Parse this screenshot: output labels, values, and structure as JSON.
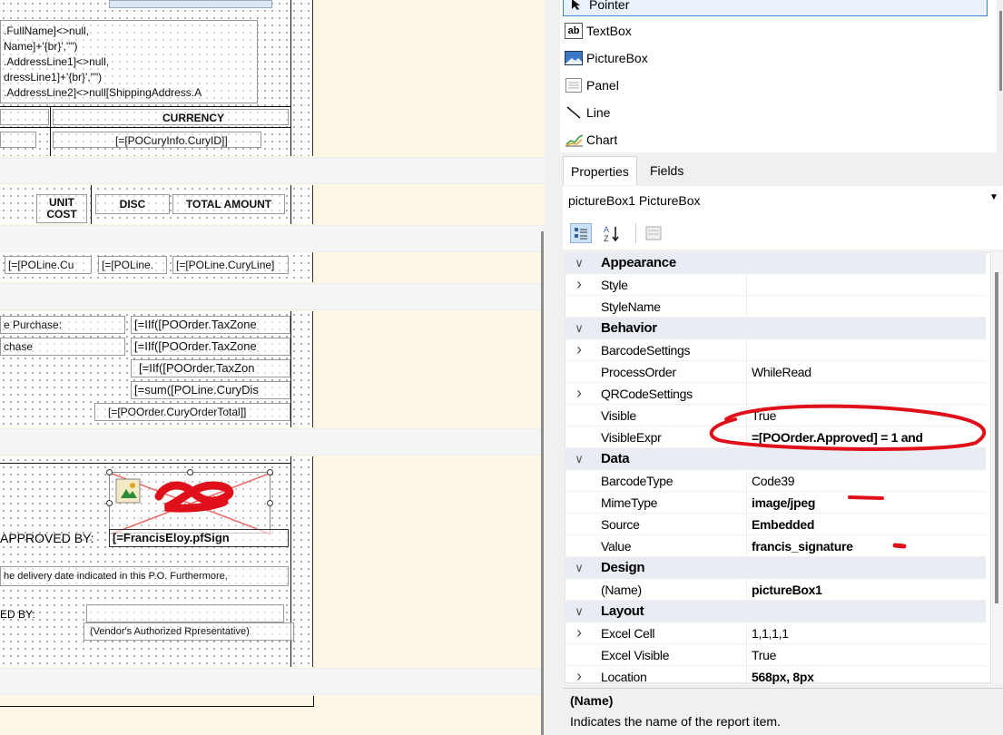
{
  "designer": {
    "detail_lines": [
      ".FullName]<>null,",
      "Name]+'{br}',\"\")",
      ".AddressLine1]<>null,",
      "dressLine1]+'{br}',\"\")",
      ".AddressLine2]<>null[ShippingAddress.A"
    ],
    "currency_header": "CURRENCY",
    "currency_value": "[=[POCuryInfo.CuryID]]",
    "col_unit_cost": "UNIT COST",
    "col_disc": "DISC",
    "col_total_amount": "TOTAL AMOUNT",
    "line_cells": [
      "[=[POLine.Cu",
      "[=[POLine.",
      "[=[POLine.CuryLine]"
    ],
    "summary_labels": [
      "e Purchase:",
      "chase"
    ],
    "summary_values": [
      "[=IIf([POOrder.TaxZone",
      "[=IIf([POOrder.TaxZone",
      "[=IIf([POOrder.TaxZon",
      "[=sum([POLine.CuryDis",
      "[=[POOrder.CuryOrderTotal]]"
    ],
    "approved_by_label": "APPROVED BY:",
    "approved_by_value": "[=FrancisEloy.pfSign",
    "terms_text": "he delivery date indicated in this P.O. Furthermore,",
    "received_by_label": "ED BY:",
    "vendor_rep": "(Vendor's Authorized Rpresentative)"
  },
  "toolbox": {
    "items": [
      {
        "label": "Pointer",
        "icon": "pointer-icon"
      },
      {
        "label": "TextBox",
        "icon": "textbox-icon"
      },
      {
        "label": "PictureBox",
        "icon": "picturebox-icon"
      },
      {
        "label": "Panel",
        "icon": "panel-icon"
      },
      {
        "label": "Line",
        "icon": "line-icon"
      },
      {
        "label": "Chart",
        "icon": "chart-icon"
      }
    ]
  },
  "tabs": {
    "properties": "Properties",
    "fields": "Fields"
  },
  "object_selector": "pictureBox1 PictureBox",
  "property_grid": {
    "rows": [
      {
        "kind": "category",
        "name": "Appearance"
      },
      {
        "kind": "prop",
        "name": "Style",
        "value": "",
        "expandable": true
      },
      {
        "kind": "prop",
        "name": "StyleName",
        "value": ""
      },
      {
        "kind": "category",
        "name": "Behavior"
      },
      {
        "kind": "prop",
        "name": "BarcodeSettings",
        "value": "",
        "expandable": true
      },
      {
        "kind": "prop",
        "name": "ProcessOrder",
        "value": "WhileRead"
      },
      {
        "kind": "prop",
        "name": "QRCodeSettings",
        "value": "",
        "expandable": true
      },
      {
        "kind": "prop",
        "name": "Visible",
        "value": "True"
      },
      {
        "kind": "prop",
        "name": "VisibleExpr",
        "value": "=[POOrder.Approved] = 1 and",
        "bold": true
      },
      {
        "kind": "category",
        "name": "Data"
      },
      {
        "kind": "prop",
        "name": "BarcodeType",
        "value": "Code39"
      },
      {
        "kind": "prop",
        "name": "MimeType",
        "value": "image/jpeg",
        "bold": true
      },
      {
        "kind": "prop",
        "name": "Source",
        "value": "Embedded",
        "bold": true
      },
      {
        "kind": "prop",
        "name": "Value",
        "value": "francis_signature",
        "bold": true
      },
      {
        "kind": "category",
        "name": "Design"
      },
      {
        "kind": "prop",
        "name": "(Name)",
        "value": "pictureBox1",
        "bold": true
      },
      {
        "kind": "category",
        "name": "Layout"
      },
      {
        "kind": "prop",
        "name": "Excel Cell",
        "value": "1,1,1,1",
        "expandable": true
      },
      {
        "kind": "prop",
        "name": "Excel Visible",
        "value": "True"
      },
      {
        "kind": "prop",
        "name": "Location",
        "value": "568px, 8px",
        "bold": true,
        "expandable": true
      }
    ]
  },
  "help": {
    "title": "(Name)",
    "description": "Indicates the name of the report item."
  },
  "colors": {
    "annotation_red": "#e0101a",
    "selection_blue": "#3c7fd6"
  }
}
